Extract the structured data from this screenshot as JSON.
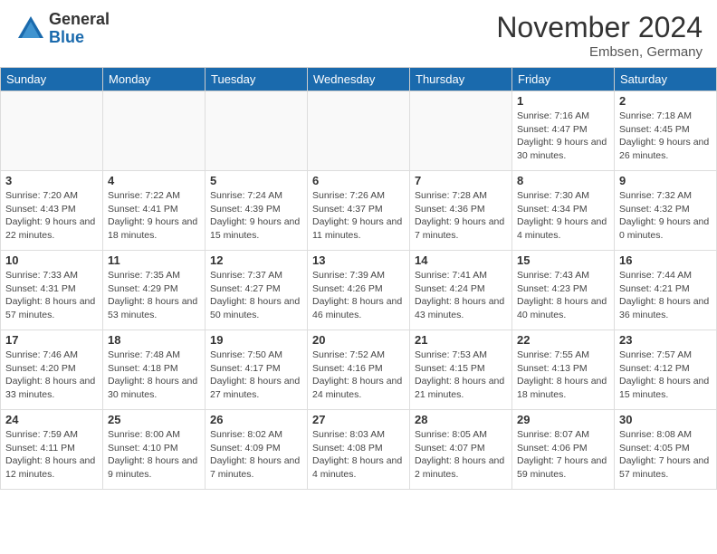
{
  "header": {
    "logo_general": "General",
    "logo_blue": "Blue",
    "month_title": "November 2024",
    "location": "Embsen, Germany"
  },
  "calendar": {
    "days_of_week": [
      "Sunday",
      "Monday",
      "Tuesday",
      "Wednesday",
      "Thursday",
      "Friday",
      "Saturday"
    ],
    "weeks": [
      [
        {
          "day": "",
          "info": ""
        },
        {
          "day": "",
          "info": ""
        },
        {
          "day": "",
          "info": ""
        },
        {
          "day": "",
          "info": ""
        },
        {
          "day": "",
          "info": ""
        },
        {
          "day": "1",
          "info": "Sunrise: 7:16 AM\nSunset: 4:47 PM\nDaylight: 9 hours and 30 minutes."
        },
        {
          "day": "2",
          "info": "Sunrise: 7:18 AM\nSunset: 4:45 PM\nDaylight: 9 hours and 26 minutes."
        }
      ],
      [
        {
          "day": "3",
          "info": "Sunrise: 7:20 AM\nSunset: 4:43 PM\nDaylight: 9 hours and 22 minutes."
        },
        {
          "day": "4",
          "info": "Sunrise: 7:22 AM\nSunset: 4:41 PM\nDaylight: 9 hours and 18 minutes."
        },
        {
          "day": "5",
          "info": "Sunrise: 7:24 AM\nSunset: 4:39 PM\nDaylight: 9 hours and 15 minutes."
        },
        {
          "day": "6",
          "info": "Sunrise: 7:26 AM\nSunset: 4:37 PM\nDaylight: 9 hours and 11 minutes."
        },
        {
          "day": "7",
          "info": "Sunrise: 7:28 AM\nSunset: 4:36 PM\nDaylight: 9 hours and 7 minutes."
        },
        {
          "day": "8",
          "info": "Sunrise: 7:30 AM\nSunset: 4:34 PM\nDaylight: 9 hours and 4 minutes."
        },
        {
          "day": "9",
          "info": "Sunrise: 7:32 AM\nSunset: 4:32 PM\nDaylight: 9 hours and 0 minutes."
        }
      ],
      [
        {
          "day": "10",
          "info": "Sunrise: 7:33 AM\nSunset: 4:31 PM\nDaylight: 8 hours and 57 minutes."
        },
        {
          "day": "11",
          "info": "Sunrise: 7:35 AM\nSunset: 4:29 PM\nDaylight: 8 hours and 53 minutes."
        },
        {
          "day": "12",
          "info": "Sunrise: 7:37 AM\nSunset: 4:27 PM\nDaylight: 8 hours and 50 minutes."
        },
        {
          "day": "13",
          "info": "Sunrise: 7:39 AM\nSunset: 4:26 PM\nDaylight: 8 hours and 46 minutes."
        },
        {
          "day": "14",
          "info": "Sunrise: 7:41 AM\nSunset: 4:24 PM\nDaylight: 8 hours and 43 minutes."
        },
        {
          "day": "15",
          "info": "Sunrise: 7:43 AM\nSunset: 4:23 PM\nDaylight: 8 hours and 40 minutes."
        },
        {
          "day": "16",
          "info": "Sunrise: 7:44 AM\nSunset: 4:21 PM\nDaylight: 8 hours and 36 minutes."
        }
      ],
      [
        {
          "day": "17",
          "info": "Sunrise: 7:46 AM\nSunset: 4:20 PM\nDaylight: 8 hours and 33 minutes."
        },
        {
          "day": "18",
          "info": "Sunrise: 7:48 AM\nSunset: 4:18 PM\nDaylight: 8 hours and 30 minutes."
        },
        {
          "day": "19",
          "info": "Sunrise: 7:50 AM\nSunset: 4:17 PM\nDaylight: 8 hours and 27 minutes."
        },
        {
          "day": "20",
          "info": "Sunrise: 7:52 AM\nSunset: 4:16 PM\nDaylight: 8 hours and 24 minutes."
        },
        {
          "day": "21",
          "info": "Sunrise: 7:53 AM\nSunset: 4:15 PM\nDaylight: 8 hours and 21 minutes."
        },
        {
          "day": "22",
          "info": "Sunrise: 7:55 AM\nSunset: 4:13 PM\nDaylight: 8 hours and 18 minutes."
        },
        {
          "day": "23",
          "info": "Sunrise: 7:57 AM\nSunset: 4:12 PM\nDaylight: 8 hours and 15 minutes."
        }
      ],
      [
        {
          "day": "24",
          "info": "Sunrise: 7:59 AM\nSunset: 4:11 PM\nDaylight: 8 hours and 12 minutes."
        },
        {
          "day": "25",
          "info": "Sunrise: 8:00 AM\nSunset: 4:10 PM\nDaylight: 8 hours and 9 minutes."
        },
        {
          "day": "26",
          "info": "Sunrise: 8:02 AM\nSunset: 4:09 PM\nDaylight: 8 hours and 7 minutes."
        },
        {
          "day": "27",
          "info": "Sunrise: 8:03 AM\nSunset: 4:08 PM\nDaylight: 8 hours and 4 minutes."
        },
        {
          "day": "28",
          "info": "Sunrise: 8:05 AM\nSunset: 4:07 PM\nDaylight: 8 hours and 2 minutes."
        },
        {
          "day": "29",
          "info": "Sunrise: 8:07 AM\nSunset: 4:06 PM\nDaylight: 7 hours and 59 minutes."
        },
        {
          "day": "30",
          "info": "Sunrise: 8:08 AM\nSunset: 4:05 PM\nDaylight: 7 hours and 57 minutes."
        }
      ]
    ]
  }
}
